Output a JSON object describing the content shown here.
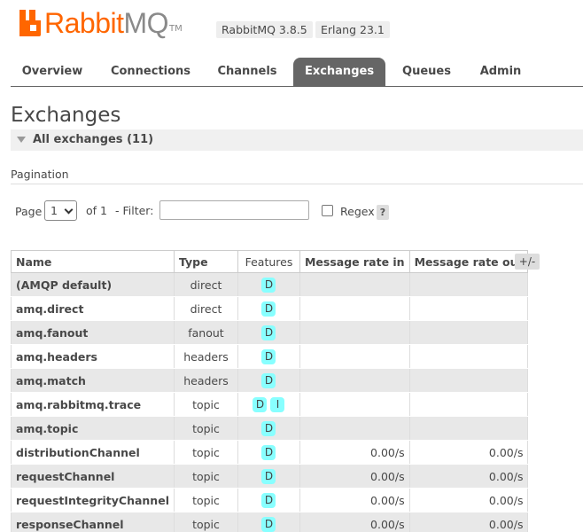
{
  "header": {
    "logo_part1": "Rabbit",
    "logo_part2": "MQ",
    "logo_tm": "TM",
    "version_badge": "RabbitMQ 3.8.5",
    "erlang_badge": "Erlang 23.1"
  },
  "tabs": [
    {
      "label": "Overview",
      "active": false
    },
    {
      "label": "Connections",
      "active": false
    },
    {
      "label": "Channels",
      "active": false
    },
    {
      "label": "Exchanges",
      "active": true
    },
    {
      "label": "Queues",
      "active": false
    },
    {
      "label": "Admin",
      "active": false
    }
  ],
  "page_title": "Exchanges",
  "section_label": "All exchanges (11)",
  "pagination": {
    "label": "Pagination",
    "page_label": "Page",
    "page_value": "1",
    "of_text": "of 1",
    "filter_label": "- Filter:",
    "filter_value": "",
    "regex_label": "Regex",
    "regex_checked": false,
    "help_label": "?"
  },
  "table": {
    "columns": [
      "Name",
      "Type",
      "Features",
      "Message rate in",
      "Message rate out"
    ],
    "toggle_label": "+/-",
    "rows": [
      {
        "name": "(AMQP default)",
        "type": "direct",
        "features": [
          "D"
        ],
        "rate_in": "",
        "rate_out": ""
      },
      {
        "name": "amq.direct",
        "type": "direct",
        "features": [
          "D"
        ],
        "rate_in": "",
        "rate_out": ""
      },
      {
        "name": "amq.fanout",
        "type": "fanout",
        "features": [
          "D"
        ],
        "rate_in": "",
        "rate_out": ""
      },
      {
        "name": "amq.headers",
        "type": "headers",
        "features": [
          "D"
        ],
        "rate_in": "",
        "rate_out": ""
      },
      {
        "name": "amq.match",
        "type": "headers",
        "features": [
          "D"
        ],
        "rate_in": "",
        "rate_out": ""
      },
      {
        "name": "amq.rabbitmq.trace",
        "type": "topic",
        "features": [
          "D",
          "I"
        ],
        "rate_in": "",
        "rate_out": ""
      },
      {
        "name": "amq.topic",
        "type": "topic",
        "features": [
          "D"
        ],
        "rate_in": "",
        "rate_out": ""
      },
      {
        "name": "distributionChannel",
        "type": "topic",
        "features": [
          "D"
        ],
        "rate_in": "0.00/s",
        "rate_out": "0.00/s"
      },
      {
        "name": "requestChannel",
        "type": "topic",
        "features": [
          "D"
        ],
        "rate_in": "0.00/s",
        "rate_out": "0.00/s"
      },
      {
        "name": "requestIntegrityChannel",
        "type": "topic",
        "features": [
          "D"
        ],
        "rate_in": "0.00/s",
        "rate_out": "0.00/s"
      },
      {
        "name": "responseChannel",
        "type": "topic",
        "features": [
          "D"
        ],
        "rate_in": "0.00/s",
        "rate_out": "0.00/s"
      }
    ]
  }
}
